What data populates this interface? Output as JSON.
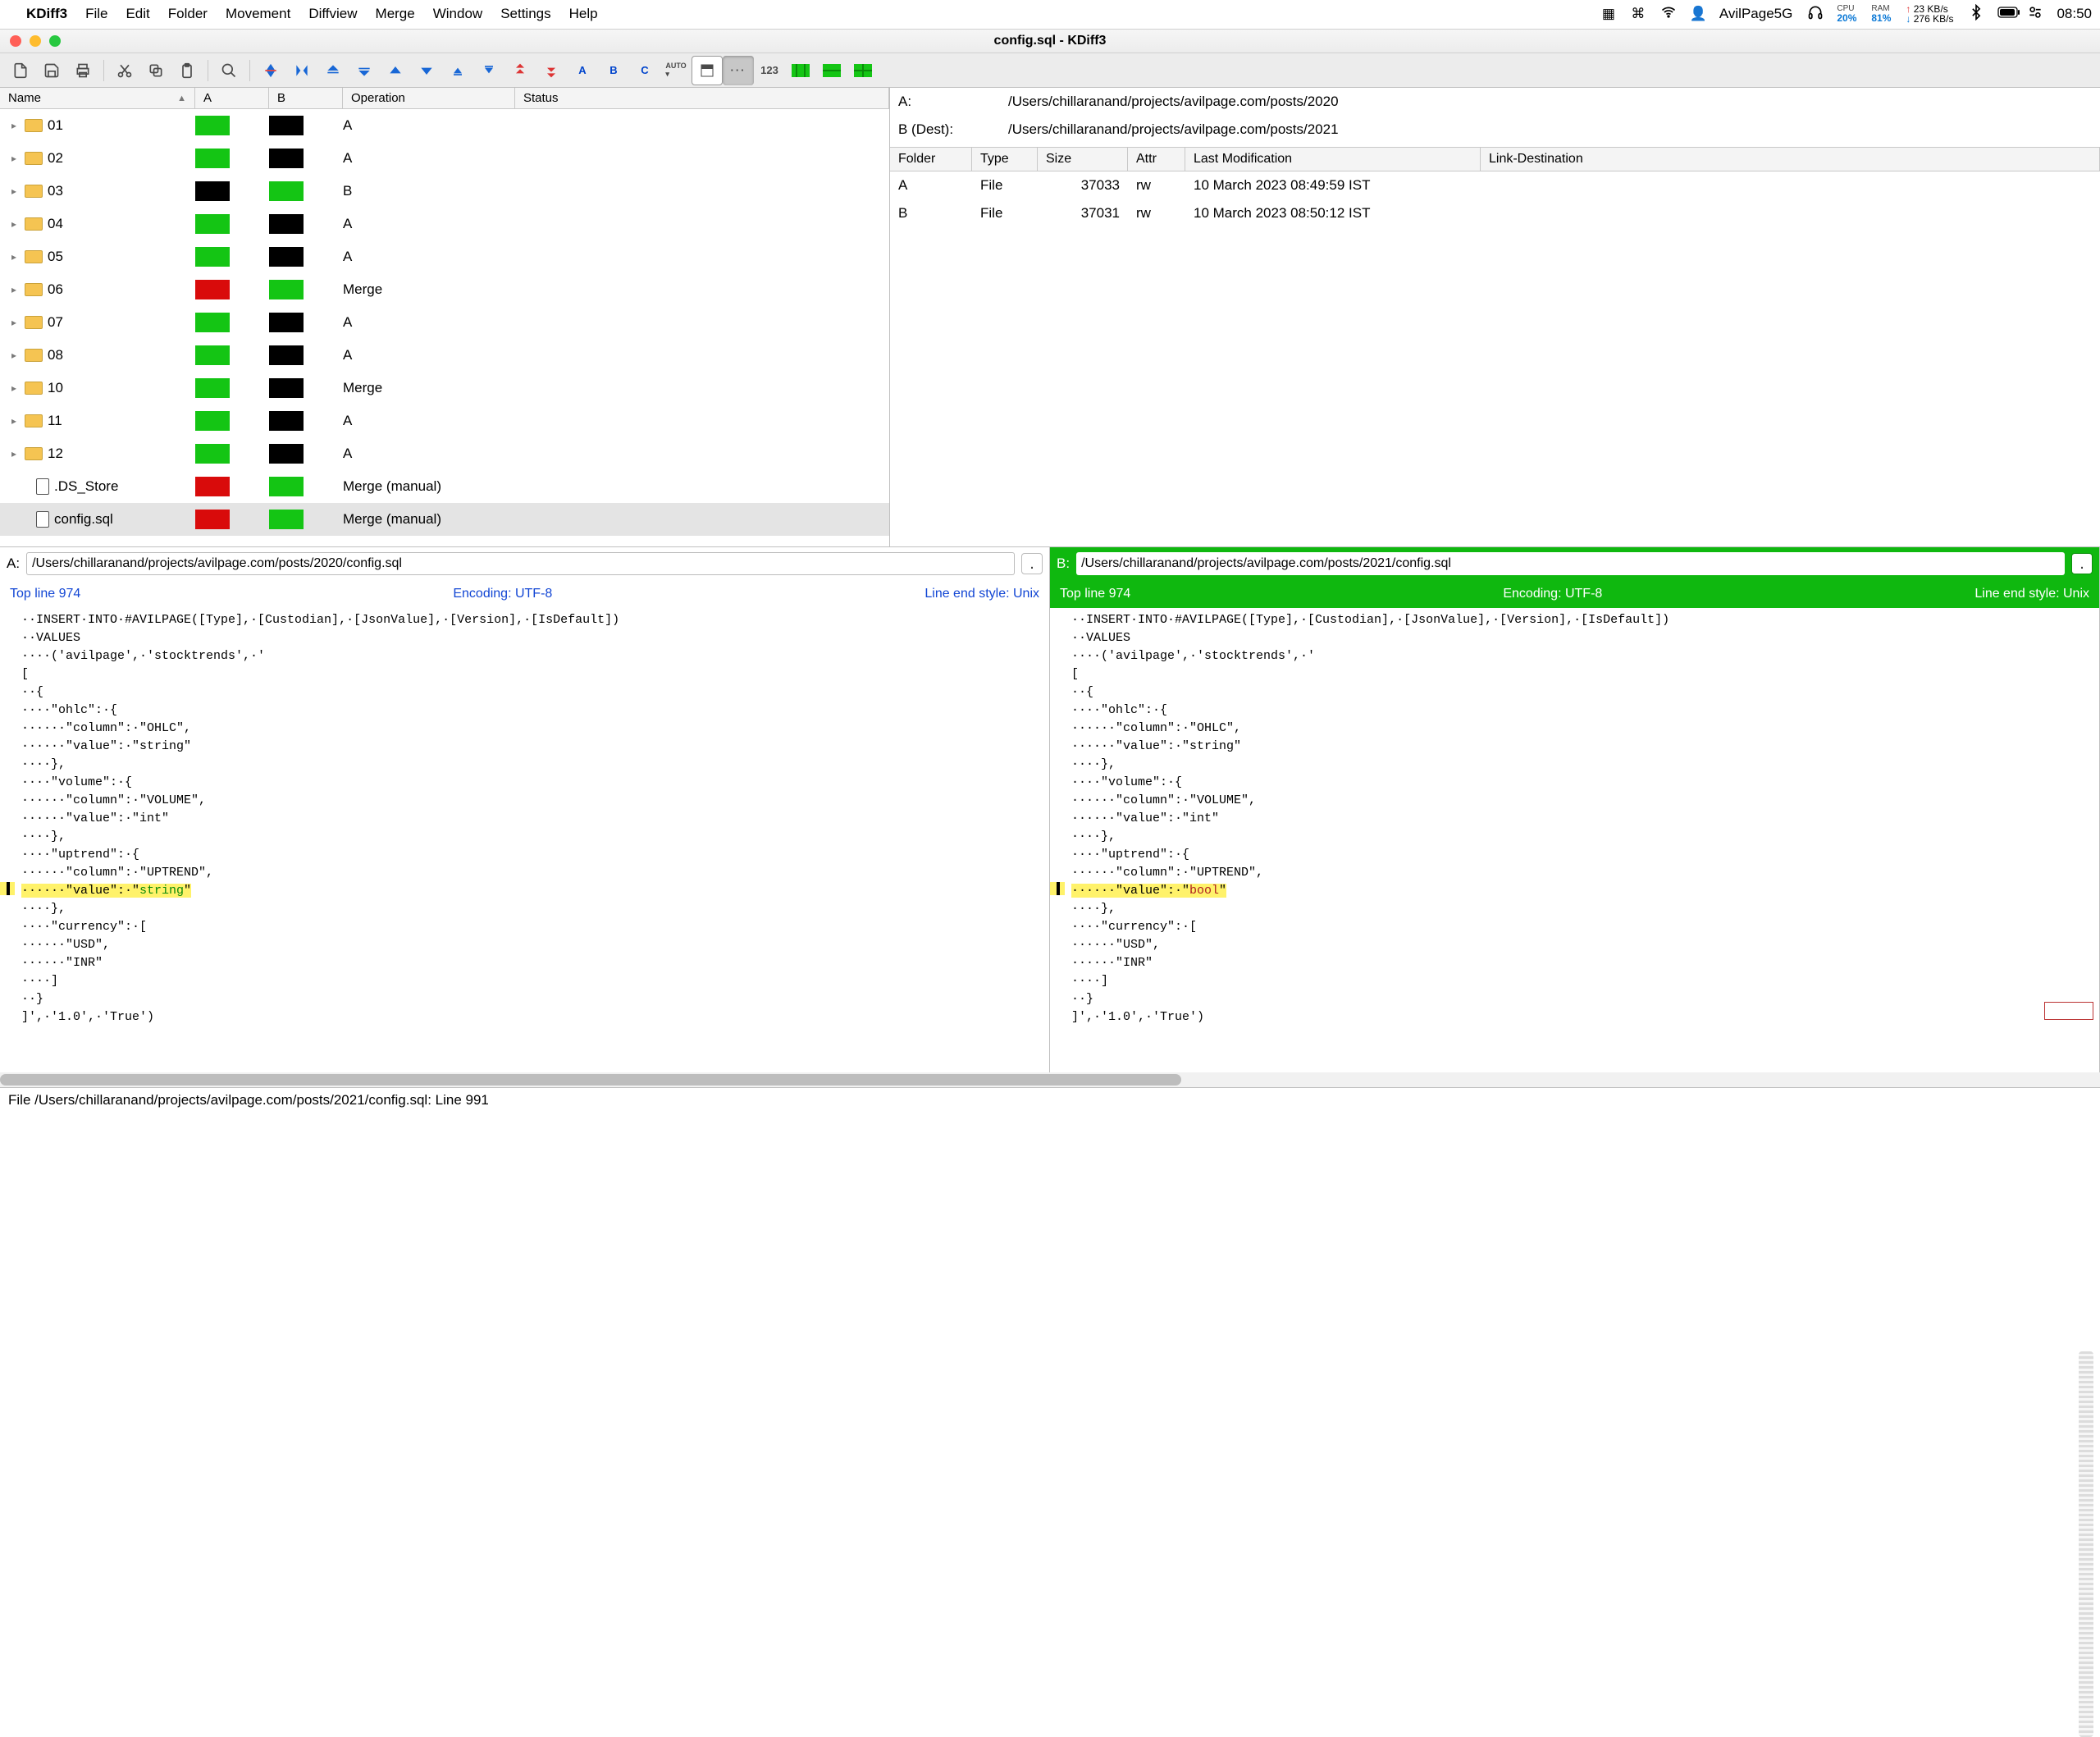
{
  "menubar": {
    "app": "KDiff3",
    "items": [
      "File",
      "Edit",
      "Folder",
      "Movement",
      "Diffview",
      "Merge",
      "Window",
      "Settings",
      "Help"
    ],
    "wifi_name": "AvilPage5G",
    "cpu": {
      "label": "CPU",
      "value": "20%"
    },
    "ram": {
      "label": "RAM",
      "value": "81%"
    },
    "net_up": "23 KB/s",
    "net_down": "276 KB/s",
    "clock": "08:50"
  },
  "window": {
    "title": "config.sql - KDiff3"
  },
  "toolbar": {
    "line_number": "123"
  },
  "tree": {
    "headers": {
      "name": "Name",
      "a": "A",
      "b": "B",
      "oper": "Operation",
      "status": "Status"
    },
    "rows": [
      {
        "name": "01",
        "kind": "folder",
        "a": "gg",
        "b": "kk",
        "op": "A"
      },
      {
        "name": "02",
        "kind": "folder",
        "a": "gg",
        "b": "kk",
        "op": "A"
      },
      {
        "name": "03",
        "kind": "folder",
        "a": "kk",
        "b": "gg",
        "op": "B"
      },
      {
        "name": "04",
        "kind": "folder",
        "a": "gg",
        "b": "kk",
        "op": "A"
      },
      {
        "name": "05",
        "kind": "folder",
        "a": "gg",
        "b": "kk",
        "op": "A"
      },
      {
        "name": "06",
        "kind": "folder",
        "a": "rr",
        "b": "gg",
        "op": "Merge"
      },
      {
        "name": "07",
        "kind": "folder",
        "a": "gg",
        "b": "kk",
        "op": "A"
      },
      {
        "name": "08",
        "kind": "folder",
        "a": "gg",
        "b": "kk",
        "op": "A"
      },
      {
        "name": "10",
        "kind": "folder",
        "a": "gg",
        "b": "kk",
        "op": "Merge"
      },
      {
        "name": "11",
        "kind": "folder",
        "a": "gg",
        "b": "kk",
        "op": "A"
      },
      {
        "name": "12",
        "kind": "folder",
        "a": "gg",
        "b": "kk",
        "op": "A"
      },
      {
        "name": ".DS_Store",
        "kind": "file",
        "a": "rr",
        "b": "gg",
        "op": "Merge (manual)"
      },
      {
        "name": "config.sql",
        "kind": "file",
        "a": "rr",
        "b": "gg",
        "op": "Merge (manual)",
        "selected": true
      }
    ]
  },
  "props": {
    "A_label": "A:",
    "A_path": "/Users/chillaranand/projects/avilpage.com/posts/2020",
    "B_label": "B (Dest):",
    "B_path": "/Users/chillaranand/projects/avilpage.com/posts/2021",
    "headers": {
      "folder": "Folder",
      "type": "Type",
      "size": "Size",
      "attr": "Attr",
      "lm": "Last Modification",
      "ld": "Link-Destination"
    },
    "rows": [
      {
        "folder": "A",
        "type": "File",
        "size": "37033",
        "attr": "rw",
        "lm": "10 March 2023 08:49:59 IST"
      },
      {
        "folder": "B",
        "type": "File",
        "size": "37031",
        "attr": "rw",
        "lm": "10 March 2023 08:50:12 IST"
      }
    ]
  },
  "diff": {
    "A": {
      "label": "A:",
      "path": "/Users/chillaranand/projects/avilpage.com/posts/2020/config.sql",
      "top": "Top line 974",
      "enc": "Encoding: UTF-8",
      "eol": "Line end style: Unix",
      "code_pre": "··INSERT·INTO·#AVILPAGE([Type],·[Custodian],·[JsonValue],·[Version],·[IsDefault])\n··VALUES\n····('avilpage',·'stocktrends',·'\n[\n··{\n····\"ohlc\":·{\n······\"column\":·\"OHLC\",\n······\"value\":·\"string\"\n····},\n····\"volume\":·{\n······\"column\":·\"VOLUME\",\n······\"value\":·\"int\"\n····},\n····\"uptrend\":·{\n······\"column\":·\"UPTREND\",\n",
      "code_diff_pre": "······\"value\":·\"",
      "code_diff_token": "string",
      "code_diff_post": "\"",
      "code_post": "····},\n····\"currency\":·[\n······\"USD\",\n······\"INR\"\n····]\n··}\n]',·'1.0',·'True')"
    },
    "B": {
      "label": "B:",
      "path": "/Users/chillaranand/projects/avilpage.com/posts/2021/config.sql",
      "top": "Top line 974",
      "enc": "Encoding: UTF-8",
      "eol": "Line end style: Unix",
      "code_pre": "··INSERT·INTO·#AVILPAGE([Type],·[Custodian],·[JsonValue],·[Version],·[IsDefault])\n··VALUES\n····('avilpage',·'stocktrends',·'\n[\n··{\n····\"ohlc\":·{\n······\"column\":·\"OHLC\",\n······\"value\":·\"string\"\n····},\n····\"volume\":·{\n······\"column\":·\"VOLUME\",\n······\"value\":·\"int\"\n····},\n····\"uptrend\":·{\n······\"column\":·\"UPTREND\",\n",
      "code_diff_pre": "······\"value\":·\"",
      "code_diff_token": "bool",
      "code_diff_post": "\"",
      "code_post": "····},\n····\"currency\":·[\n······\"USD\",\n······\"INR\"\n····]\n··}\n]',·'1.0',·'True')"
    }
  },
  "status": "File /Users/chillaranand/projects/avilpage.com/posts/2021/config.sql: Line 991"
}
